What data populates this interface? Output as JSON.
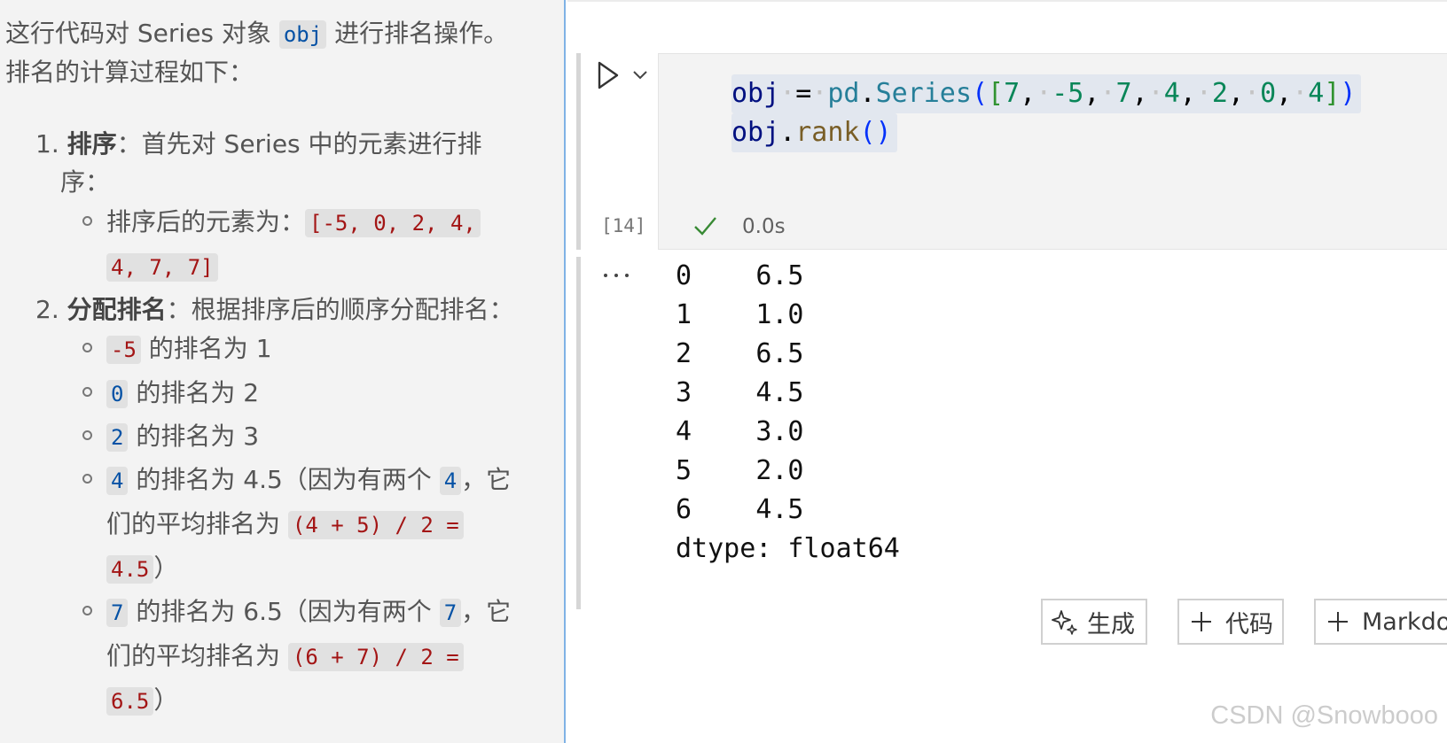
{
  "explanation": {
    "intro_prefix": "这行代码对 Series 对象 ",
    "intro_code": "obj",
    "intro_suffix": " 进行排名操作。",
    "intro_line2": "排名的计算过程如下：",
    "step1": {
      "number": "1.",
      "title": "排序",
      "text_line1": "：首先对 Series 中的元素进行排",
      "text_line2": "序：",
      "sub_label": "排序后的元素为：",
      "sorted_code_line1": "[-5, 0, 2, 4,",
      "sorted_code_line2": "4, 7, 7]"
    },
    "step2": {
      "number": "2.",
      "title": "分配排名",
      "text": "：根据排序后的顺序分配排名：",
      "items": [
        {
          "code": "-5",
          "text": " 的排名为 1"
        },
        {
          "code": "0",
          "text": " 的排名为 2"
        },
        {
          "code": "2",
          "text": " 的排名为 3"
        }
      ],
      "tie_items": [
        {
          "code": "4",
          "text_a": " 的排名为 4.5（因为有两个 ",
          "code_b": "4",
          "text_b": "，它",
          "line2_text": "们的平均排名为 ",
          "formula_line1": "(4 + 5) / 2 =",
          "formula_line2": "4.5",
          "close": "）"
        },
        {
          "code": "7",
          "text_a": " 的排名为 6.5（因为有两个 ",
          "code_b": "7",
          "text_b": "，它",
          "line2_text": "们的平均排名为 ",
          "formula_line1": "(6 + 7) / 2 =",
          "formula_line2": "6.5",
          "close": "）"
        }
      ]
    }
  },
  "notebook": {
    "cell": {
      "code_line1": {
        "var": "obj",
        "op": "=",
        "module": "pd",
        "dot": ".",
        "func": "Series",
        "values": [
          "7",
          "-5",
          "7",
          "4",
          "2",
          "0",
          "4"
        ]
      },
      "code_line2": {
        "var": "obj",
        "dot": ".",
        "method": "rank",
        "parens": "()"
      },
      "execution_count": "[14]",
      "duration": "0.0s"
    },
    "output": {
      "rows": [
        {
          "index": "0",
          "value": "6.5"
        },
        {
          "index": "1",
          "value": "1.0"
        },
        {
          "index": "2",
          "value": "6.5"
        },
        {
          "index": "3",
          "value": "4.5"
        },
        {
          "index": "4",
          "value": "3.0"
        },
        {
          "index": "5",
          "value": "2.0"
        },
        {
          "index": "6",
          "value": "4.5"
        }
      ],
      "dtype_line": "dtype: float64"
    },
    "buttons": {
      "generate": "生成",
      "add_code": "代码",
      "add_markdown": "Markdown"
    }
  },
  "watermark": "CSDN @Snowbooo",
  "icons": [
    "play-icon",
    "chevron-down-icon",
    "checkmark-icon",
    "more-horizontal-icon",
    "sparkle-icon",
    "plus-icon"
  ],
  "colors": {
    "left_bg": "#f3f3f3",
    "editor_bg": "#f3f3f3",
    "focus_border": "#7fb2e5",
    "inline_code_red": "#a31515",
    "inline_code_blue": "#0451a5",
    "check_green": "#388a34"
  }
}
